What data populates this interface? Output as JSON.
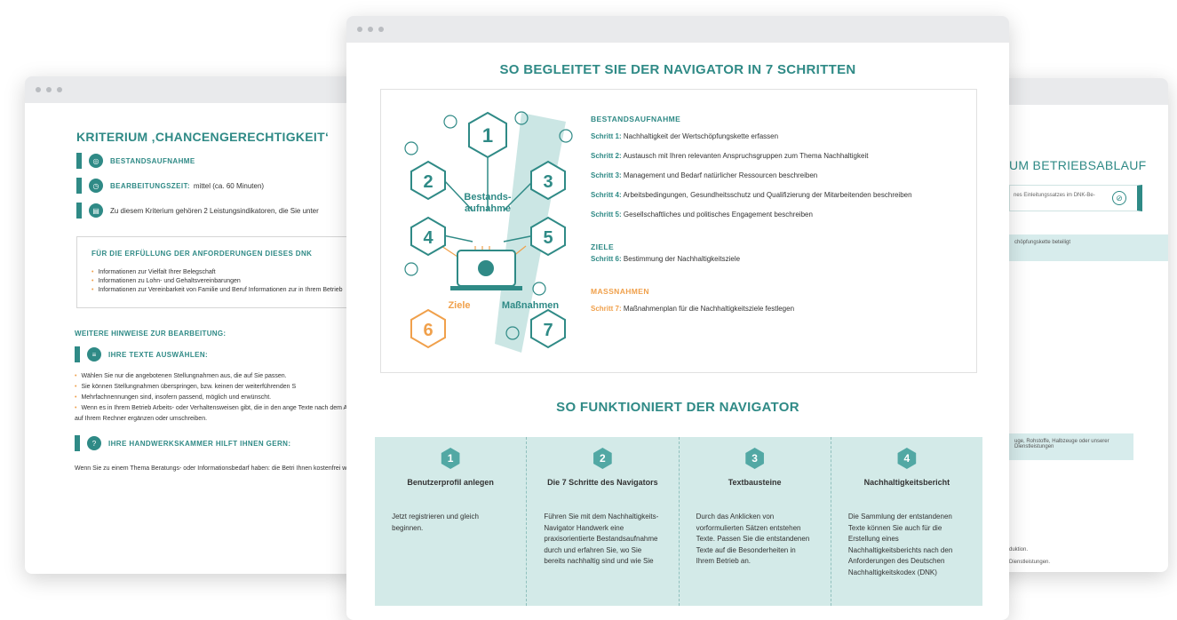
{
  "left": {
    "title": "KRITERIUM ‚CHANCENGERECHTIGKEIT‘",
    "row1": "BESTANDSAUFNAHME",
    "row2_label": "BEARBEITUNGSZEIT:",
    "row2_value": "mittel (ca. 60 Minuten)",
    "row3": "Zu diesem Kriterium gehören 2 Leistungsindikatoren, die Sie unter",
    "box_title": "FÜR DIE ERFÜLLUNG DER ANFORDERUNGEN DIESES DNK",
    "box_items": [
      "Informationen zur Vielfalt Ihrer Belegschaft",
      "Informationen zu Lohn- und Gehaltsvereinbarungen",
      "Informationen zur Vereinbarkeit von Familie und Beruf Informationen zur in Ihrem Betrieb"
    ],
    "hint_title": "WEITERE HINWEISE ZUR BEARBEITUNG:",
    "hint_sub": "IHRE TEXTE AUSWÄHLEN:",
    "hint_items": [
      "Wählen Sie nur die angebotenen Stellungnahmen aus, die auf Sie passen.",
      "Sie können Stellungnahmen überspringen, bzw. keinen der weiterführenden S",
      "Mehrfachnennungen sind, insofern passend, möglich und erwünscht.",
      "Wenn es in Ihrem Betrieb Arbeits- oder Verhaltensweisen gibt, die in den ange Texte nach dem Abspeichern auf Ihrem Rechner ergänzen oder umschreiben."
    ],
    "help_title": "IHRE HANDWERKSKAMMER HILFT IHNEN GERN:",
    "foot": "Wenn Sie zu einem Thema Beratungs- oder Informationsbedarf haben: die Betri Ihnen kostenfrei weiterhelfen."
  },
  "right": {
    "title": "UM BETRIEBSABLAUF",
    "pill": "nes Einleitungssatzes im DNK-Be-",
    "teal1": "chöpfungskette beteiligt",
    "teal2": "uge, Rohstoffe, Halbzeuge oder unserer Dienstleistungen",
    "small1": "duktion.",
    "small2": "Dienstleistungen."
  },
  "center": {
    "title": "SO BEGLEITET SIE DER NAVIGATOR IN 7 SCHRITTEN",
    "graphic": {
      "n1": "1",
      "n2": "2",
      "n3": "3",
      "n4": "4",
      "n5": "5",
      "n6": "6",
      "n7": "7",
      "center_label_1": "Bestands-",
      "center_label_2": "aufnahme",
      "ziele": "Ziele",
      "massnahmen": "Maßnahmen"
    },
    "sections": {
      "bestand": "BESTANDSAUFNAHME",
      "ziele": "ZIELE",
      "massnahmen": "MASSNAHMEN"
    },
    "steps": [
      {
        "label": "Schritt 1:",
        "text": "Nachhaltigkeit der Wertschöpfungskette erfassen"
      },
      {
        "label": "Schritt 2:",
        "text": "Austausch mit Ihren relevanten Anspruchsgruppen zum Thema Nachhaltigkeit"
      },
      {
        "label": "Schritt 3:",
        "text": "Management und Bedarf natürlicher Ressourcen beschreiben"
      },
      {
        "label": "Schritt 4:",
        "text": "Arbeitsbedingungen, Gesundheitsschutz und Qualifizierung der Mitarbeitenden beschreiben"
      },
      {
        "label": "Schritt 5:",
        "text": "Gesellschaftliches und politisches Engagement beschreiben"
      },
      {
        "label": "Schritt 6:",
        "text": "Bestimmung der Nachhaltigkeitsziele"
      },
      {
        "label": "Schritt 7:",
        "text": "Maßnahmenplan für die Nachhaltigkeitsziele festlegen"
      }
    ],
    "title2": "SO FUNKTIONIERT DER NAVIGATOR",
    "columns": [
      {
        "num": "1",
        "head": "Benutzerprofil anlegen",
        "body": "Jetzt registrieren und gleich beginnen."
      },
      {
        "num": "2",
        "head": "Die 7 Schritte des Navigators",
        "body": "Führen Sie mit dem Nachhaltigkeits-Navigator Handwerk eine praxisorientierte Bestandsaufnahme durch und erfahren Sie, wo Sie bereits nachhaltig sind und wie Sie"
      },
      {
        "num": "3",
        "head": "Textbausteine",
        "body": "Durch das Anklicken von vorformulierten Sätzen entstehen Texte. Passen Sie die entstandenen Texte auf die Besonderheiten in Ihrem Betrieb an."
      },
      {
        "num": "4",
        "head": "Nachhaltigkeitsbericht",
        "body": "Die Sammlung der entstandenen Texte können Sie auch für die Erstellung eines Nachhaltigkeitsberichts nach den Anforderungen des Deutschen Nachhaltigkeitskodex (DNK)"
      }
    ],
    "colors": {
      "teal": "#2f8a86",
      "orange": "#f0a04b",
      "panel_bg": "#d3eae8"
    }
  }
}
